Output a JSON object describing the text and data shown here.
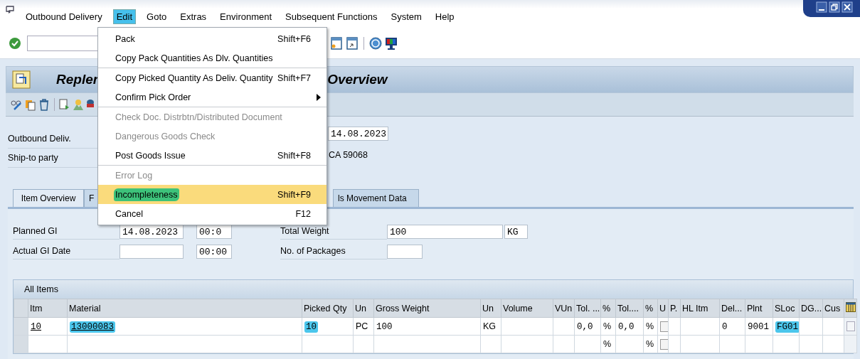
{
  "menu_bar": [
    {
      "label": "Outbound Delivery",
      "selected": false
    },
    {
      "label": "Edit",
      "selected": true
    },
    {
      "label": "Goto",
      "selected": false
    },
    {
      "label": "Extras",
      "selected": false
    },
    {
      "label": "Environment",
      "selected": false
    },
    {
      "label": "Subsequent Functions",
      "selected": false
    },
    {
      "label": "System",
      "selected": false
    },
    {
      "label": "Help",
      "selected": false
    }
  ],
  "edit_menu": [
    {
      "kind": "item",
      "label": "Pack",
      "shortcut": "Shift+F6",
      "disabled": false,
      "selected": false
    },
    {
      "kind": "item",
      "label": "Copy Pack Quantities As Dlv. Quantities",
      "disabled": false,
      "selected": false
    },
    {
      "kind": "separator"
    },
    {
      "kind": "item",
      "label": "Copy Picked Quantity As Deliv. Quantity",
      "shortcut": "Shift+F7",
      "disabled": false,
      "selected": false
    },
    {
      "kind": "submenu",
      "label": "Confirm Pick Order",
      "disabled": false,
      "selected": false
    },
    {
      "kind": "separator"
    },
    {
      "kind": "item",
      "label": "Check Doc. Distrbtn/Distributed Document",
      "disabled": true,
      "selected": false
    },
    {
      "kind": "item",
      "label": "Dangerous Goods Check",
      "disabled": true,
      "selected": false
    },
    {
      "kind": "item",
      "label": "Post Goods Issue",
      "shortcut": "Shift+F8",
      "disabled": false,
      "selected": false
    },
    {
      "kind": "separator"
    },
    {
      "kind": "item",
      "label": "Error Log",
      "disabled": true,
      "selected": false
    },
    {
      "kind": "item",
      "label": "Incompleteness",
      "shortcut": "Shift+F9",
      "disabled": false,
      "selected": true,
      "marker": true
    },
    {
      "kind": "item",
      "label": "Cancel",
      "shortcut": "F12",
      "disabled": false,
      "selected": false
    }
  ],
  "title": {
    "visible_start": "Repler",
    "visible_end": "Overview"
  },
  "header": {
    "outbound_delivery_label": "Outbound Deliv.",
    "document_date": "14.08.2023",
    "ship_to_label": "Ship-to party",
    "ship_to_value": "CA 59068"
  },
  "tabs": [
    {
      "label": "Item Overview",
      "selected": true
    },
    {
      "label": "F",
      "selected": false
    },
    {
      "label": "ls Movement Data",
      "selected": false
    }
  ],
  "fields": {
    "planned_gi_label": "Planned GI",
    "planned_gi_date": "14.08.2023",
    "planned_gi_time": "00:0",
    "actual_gi_label": "Actual GI Date",
    "actual_gi_time": "00:00",
    "total_weight_label": "Total Weight",
    "total_weight": "100",
    "weight_unit": "KG",
    "packages_label": "No. of Packages"
  },
  "table": {
    "title": "All Items",
    "columns": [
      "Itm",
      "Material",
      "Picked Qty",
      "Un",
      "Gross Weight",
      "Un",
      "Volume",
      "VUn",
      "Tol. ...",
      "%",
      "Tol....",
      "%",
      "U",
      "P.",
      "HL Itm",
      "Del...",
      "Plnt",
      "SLoc",
      "DG...",
      "Cus"
    ],
    "rows": [
      {
        "cells": [
          {
            "kind": "link",
            "text": "10",
            "highlighted": false
          },
          {
            "kind": "link",
            "text": "13000083",
            "highlighted": true
          },
          {
            "kind": "value",
            "text": "10",
            "highlighted": true
          },
          {
            "kind": "text",
            "text": "PC"
          },
          {
            "kind": "value",
            "text": "100"
          },
          {
            "kind": "text",
            "text": "KG"
          },
          {
            "kind": "empty"
          },
          {
            "kind": "empty"
          },
          {
            "kind": "value",
            "text": "0,0"
          },
          {
            "kind": "text",
            "text": "%"
          },
          {
            "kind": "value",
            "text": "0,0"
          },
          {
            "kind": "text",
            "text": "%"
          },
          {
            "kind": "check",
            "checked": false
          },
          {
            "kind": "empty"
          },
          {
            "kind": "empty"
          },
          {
            "kind": "value",
            "text": "0"
          },
          {
            "kind": "value",
            "text": "9001"
          },
          {
            "kind": "value",
            "text": "FG01",
            "highlighted": true
          },
          {
            "kind": "empty"
          },
          {
            "kind": "empty"
          }
        ]
      },
      {
        "cells": [
          {
            "kind": "empty"
          },
          {
            "kind": "empty"
          },
          {
            "kind": "empty"
          },
          {
            "kind": "empty"
          },
          {
            "kind": "empty"
          },
          {
            "kind": "empty"
          },
          {
            "kind": "empty"
          },
          {
            "kind": "empty"
          },
          {
            "kind": "empty"
          },
          {
            "kind": "text",
            "text": "%"
          },
          {
            "kind": "empty"
          },
          {
            "kind": "text",
            "text": "%"
          },
          {
            "kind": "check",
            "checked": false
          },
          {
            "kind": "empty"
          },
          {
            "kind": "empty"
          },
          {
            "kind": "empty"
          },
          {
            "kind": "empty"
          },
          {
            "kind": "empty"
          },
          {
            "kind": "empty"
          },
          {
            "kind": "empty"
          }
        ]
      }
    ]
  }
}
